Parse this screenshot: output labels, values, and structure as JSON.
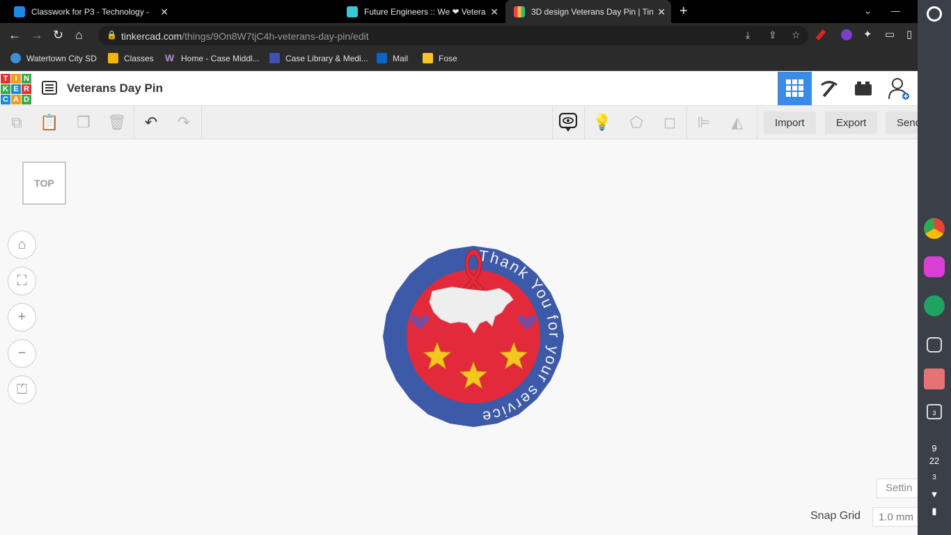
{
  "browser": {
    "tabs": [
      {
        "title": "Classwork for P3 - Technology - ",
        "active": false
      },
      {
        "title": "Future Engineers :: We ❤ Vetera",
        "active": false
      },
      {
        "title": "3D design Veterans Day Pin | Tin",
        "active": true
      }
    ],
    "url_domain": "tinkercad.com",
    "url_path": "/things/9On8W7tjC4h-veterans-day-pin/edit",
    "bookmarks": [
      "Watertown City SD",
      "Classes",
      "Home - Case Middl...",
      "Case Library & Medi...",
      "Mail",
      "Fose"
    ]
  },
  "tinkercad": {
    "logo_letters": [
      "T",
      "I",
      "N",
      "K",
      "E",
      "R",
      "C",
      "A",
      "D"
    ],
    "design_title": "Veterans Day Pin",
    "import_label": "Import",
    "export_label": "Export",
    "send_label": "Send",
    "viewcube_label": "TOP",
    "settings_label": "Settin",
    "snap_grid_label": "Snap Grid",
    "snap_grid_value": "1.0 mm"
  },
  "pin": {
    "ring_text": "Thank You for your service",
    "colors": {
      "ring": "#3d5aa8",
      "center": "#e22a3a",
      "stars": "#f2c81e",
      "map": "#eeeeee",
      "hearts": "#7a4aa0"
    }
  },
  "shelf": {
    "clock_hour": "9",
    "clock_minute": "22",
    "notification_count": "3",
    "desk_count": "3"
  }
}
